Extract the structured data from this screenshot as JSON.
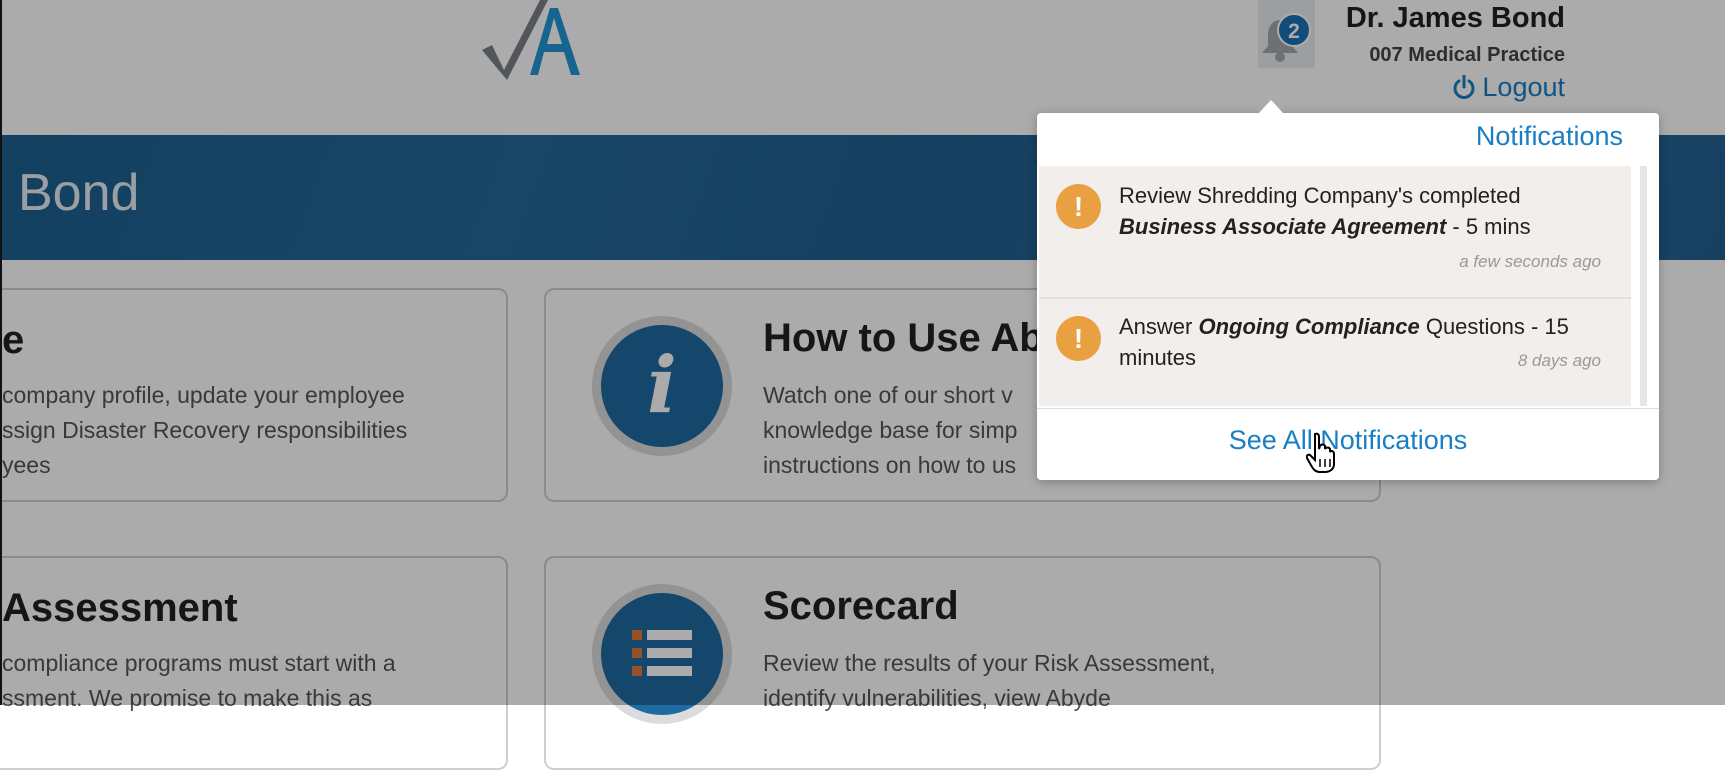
{
  "header": {
    "user_name": "Dr. James Bond",
    "practice": "007 Medical Practice",
    "logout_label": "Logout",
    "notification_count": "2"
  },
  "banner": {
    "title": "Bond"
  },
  "cards": [
    {
      "title": "e",
      "lines": [
        "company profile, update your employee",
        "ssign Disaster Recovery responsibilities",
        "yees"
      ]
    },
    {
      "title": "How to Use Ab",
      "lines": [
        "Watch one of our short v",
        "knowledge base for simp",
        "instructions on how to us"
      ],
      "icon": "info-icon"
    },
    {
      "title": "Assessment",
      "lines": [
        "compliance programs must start with a",
        "ssment. We promise to make this as"
      ]
    },
    {
      "title": "Scorecard",
      "lines": [
        "Review the results of your Risk Assessment,",
        "identify vulnerabilities, view Abyde"
      ],
      "icon": "list-icon"
    }
  ],
  "notifications": {
    "header": "Notifications",
    "items": [
      {
        "line1": "Review Shredding Company's completed",
        "emphasis": "Business Associate Agreement",
        "suffix": " - 5 mins",
        "time": "a few seconds ago"
      },
      {
        "prefix": "Answer ",
        "emphasis": "Ongoing Compliance",
        "suffix": " Questions - 15",
        "line2": "minutes",
        "time": "8 days ago"
      }
    ],
    "see_all": "See All Notifications"
  },
  "colors": {
    "accent": "#1a7ec3",
    "warning": "#e9a041",
    "banner": "#1d5f8f",
    "badge": "#1a74b8"
  }
}
